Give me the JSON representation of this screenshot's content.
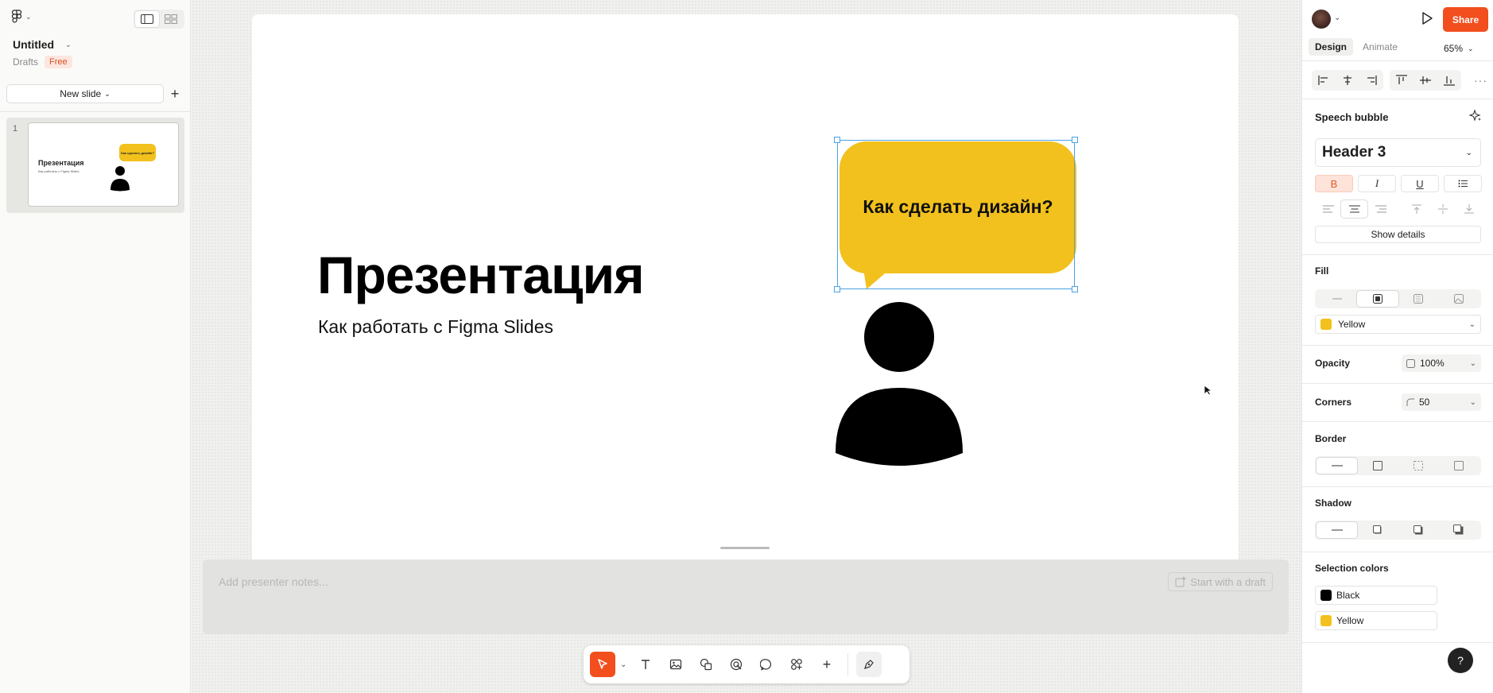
{
  "file": {
    "name": "Untitled",
    "location": "Drafts",
    "plan_badge": "Free"
  },
  "sidebar": {
    "new_slide_label": "New slide",
    "slides": [
      {
        "number": "1",
        "title": "Презентация",
        "subtitle": "Как работать с Figma Slides",
        "bubble": "Как сделать дизайн?"
      }
    ]
  },
  "slide": {
    "title": "Презентация",
    "subtitle": "Как работать с Figma Slides",
    "bubble_text": "Как сделать дизайн?"
  },
  "notes": {
    "placeholder": "Add presenter notes...",
    "draft_button": "Start with a draft"
  },
  "toolbar": {
    "tools": [
      "move-tool",
      "text-tool",
      "image-tool",
      "shapes-tool",
      "interactive-tool",
      "comment-tool",
      "widgets-tool",
      "add-tool",
      "dev-mode-tool"
    ]
  },
  "panel": {
    "share_label": "Share",
    "tabs": [
      {
        "label": "Design",
        "active": true
      },
      {
        "label": "Animate",
        "active": false
      }
    ],
    "zoom": "65%",
    "layer_name": "Speech bubble",
    "text_style": "Header 3",
    "format": {
      "bold": "B",
      "italic": "I",
      "underline": "U"
    },
    "show_details": "Show details",
    "fill": {
      "title": "Fill",
      "color_name": "Yellow",
      "color": "#F2C11D"
    },
    "opacity": {
      "label": "Opacity",
      "value": "100%"
    },
    "corners": {
      "label": "Corners",
      "value": "50"
    },
    "border_title": "Border",
    "shadow_title": "Shadow",
    "selection_colors": {
      "title": "Selection colors",
      "items": [
        {
          "name": "Black",
          "color": "#000000"
        },
        {
          "name": "Yellow",
          "color": "#F2C11D"
        }
      ]
    },
    "help": "?"
  },
  "colors": {
    "accent": "#F24E1E",
    "selection": "#4AA2E6",
    "bubble": "#F2C11D"
  }
}
